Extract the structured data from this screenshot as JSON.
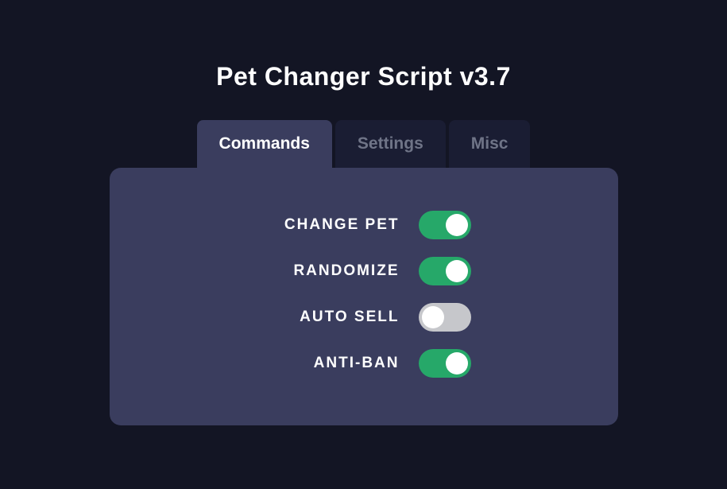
{
  "title": "Pet Changer Script v3.7",
  "tabs": [
    {
      "label": "Commands",
      "active": true
    },
    {
      "label": "Settings",
      "active": false
    },
    {
      "label": "Misc",
      "active": false
    }
  ],
  "options": [
    {
      "label": "CHANGE PET",
      "enabled": true
    },
    {
      "label": "RANDOMIZE",
      "enabled": true
    },
    {
      "label": "AUTO SELL",
      "enabled": false
    },
    {
      "label": "ANTI-BAN",
      "enabled": true
    }
  ]
}
